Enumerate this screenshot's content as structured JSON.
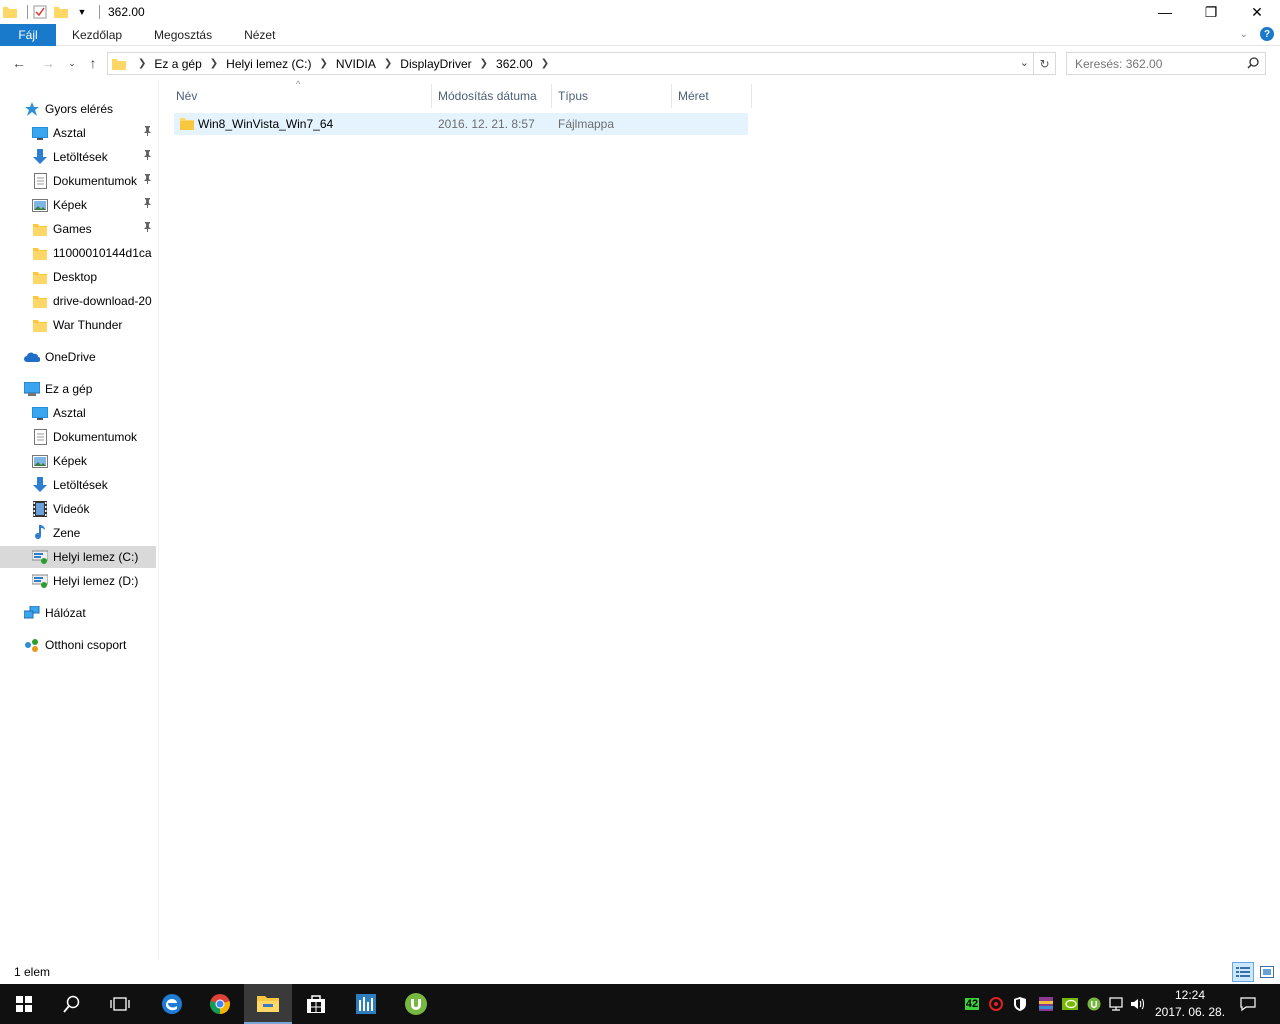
{
  "window": {
    "title": "362.00",
    "controls": {
      "minimize": "—",
      "maximize": "❐",
      "close": "✕"
    }
  },
  "ribbon": {
    "tabs": [
      "Fájl",
      "Kezdőlap",
      "Megosztás",
      "Nézet"
    ],
    "help": "?"
  },
  "address": {
    "crumbs": [
      "Ez a gép",
      "Helyi lemez (C:)",
      "NVIDIA",
      "DisplayDriver",
      "362.00"
    ]
  },
  "search": {
    "placeholder": "Keresés: 362.00"
  },
  "nav": {
    "quick_access": "Gyors elérés",
    "quick_items": [
      {
        "label": "Asztal",
        "icon": "desktop-icon",
        "pinned": true
      },
      {
        "label": "Letöltések",
        "icon": "downloads-icon",
        "pinned": true
      },
      {
        "label": "Dokumentumok",
        "icon": "documents-icon",
        "pinned": true
      },
      {
        "label": "Képek",
        "icon": "pictures-icon",
        "pinned": true
      },
      {
        "label": "Games",
        "icon": "folder-icon",
        "pinned": true
      },
      {
        "label": "11000010144d1ca",
        "icon": "folder-icon",
        "pinned": false
      },
      {
        "label": "Desktop",
        "icon": "folder-icon",
        "pinned": false
      },
      {
        "label": "drive-download-20",
        "icon": "folder-icon",
        "pinned": false
      },
      {
        "label": "War Thunder",
        "icon": "folder-icon",
        "pinned": false
      }
    ],
    "onedrive": "OneDrive",
    "this_pc": "Ez a gép",
    "pc_items": [
      {
        "label": "Asztal",
        "icon": "desktop-icon"
      },
      {
        "label": "Dokumentumok",
        "icon": "documents-icon"
      },
      {
        "label": "Képek",
        "icon": "pictures-icon"
      },
      {
        "label": "Letöltések",
        "icon": "downloads-icon"
      },
      {
        "label": "Videók",
        "icon": "videos-icon"
      },
      {
        "label": "Zene",
        "icon": "music-icon"
      },
      {
        "label": "Helyi lemez (C:)",
        "icon": "drive-icon",
        "selected": true
      },
      {
        "label": "Helyi lemez (D:)",
        "icon": "drive-icon"
      }
    ],
    "network": "Hálózat",
    "homegroup": "Otthoni csoport"
  },
  "columns": {
    "name": "Név",
    "date": "Módosítás dátuma",
    "type": "Típus",
    "size": "Méret"
  },
  "files": [
    {
      "name": "Win8_WinVista_Win7_64",
      "date": "2016. 12. 21. 8:57",
      "type": "Fájlmappa",
      "size": ""
    }
  ],
  "status": {
    "count": "1 elem"
  },
  "taskbar": {
    "tray_badge": "42",
    "time": "12:24",
    "date": "2017. 06. 28."
  }
}
